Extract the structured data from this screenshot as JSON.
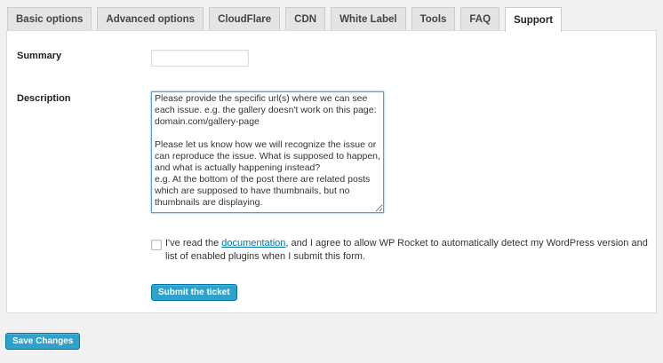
{
  "tabs": [
    {
      "label": "Basic options"
    },
    {
      "label": "Advanced options"
    },
    {
      "label": "CloudFlare"
    },
    {
      "label": "CDN"
    },
    {
      "label": "White Label"
    },
    {
      "label": "Tools"
    },
    {
      "label": "FAQ"
    },
    {
      "label": "Support",
      "active": true
    }
  ],
  "form": {
    "summary_label": "Summary",
    "summary_value": "",
    "description_label": "Description",
    "description_value": "Please provide the specific url(s) where we can see each issue. e.g. the gallery doesn't work on this page: domain.com/gallery-page\n\nPlease let us know how we will recognize the issue or can reproduce the issue. What is supposed to happen, and what is actually happening instead?\ne.g. At the bottom of the post there are related posts which are supposed to have thumbnails, but no thumbnails are displaying.",
    "consent_before": "I've read the ",
    "consent_link": "documentation",
    "consent_after": ", and I agree to allow WP Rocket to automatically detect my WordPress version and list of enabled plugins when I submit this form.",
    "consent_checked": false,
    "submit_label": "Submit the ticket"
  },
  "footer": {
    "save_label": "Save Changes"
  },
  "colors": {
    "accent": "#2ea2cc",
    "link": "#0074a2",
    "background": "#f1f1f1"
  }
}
